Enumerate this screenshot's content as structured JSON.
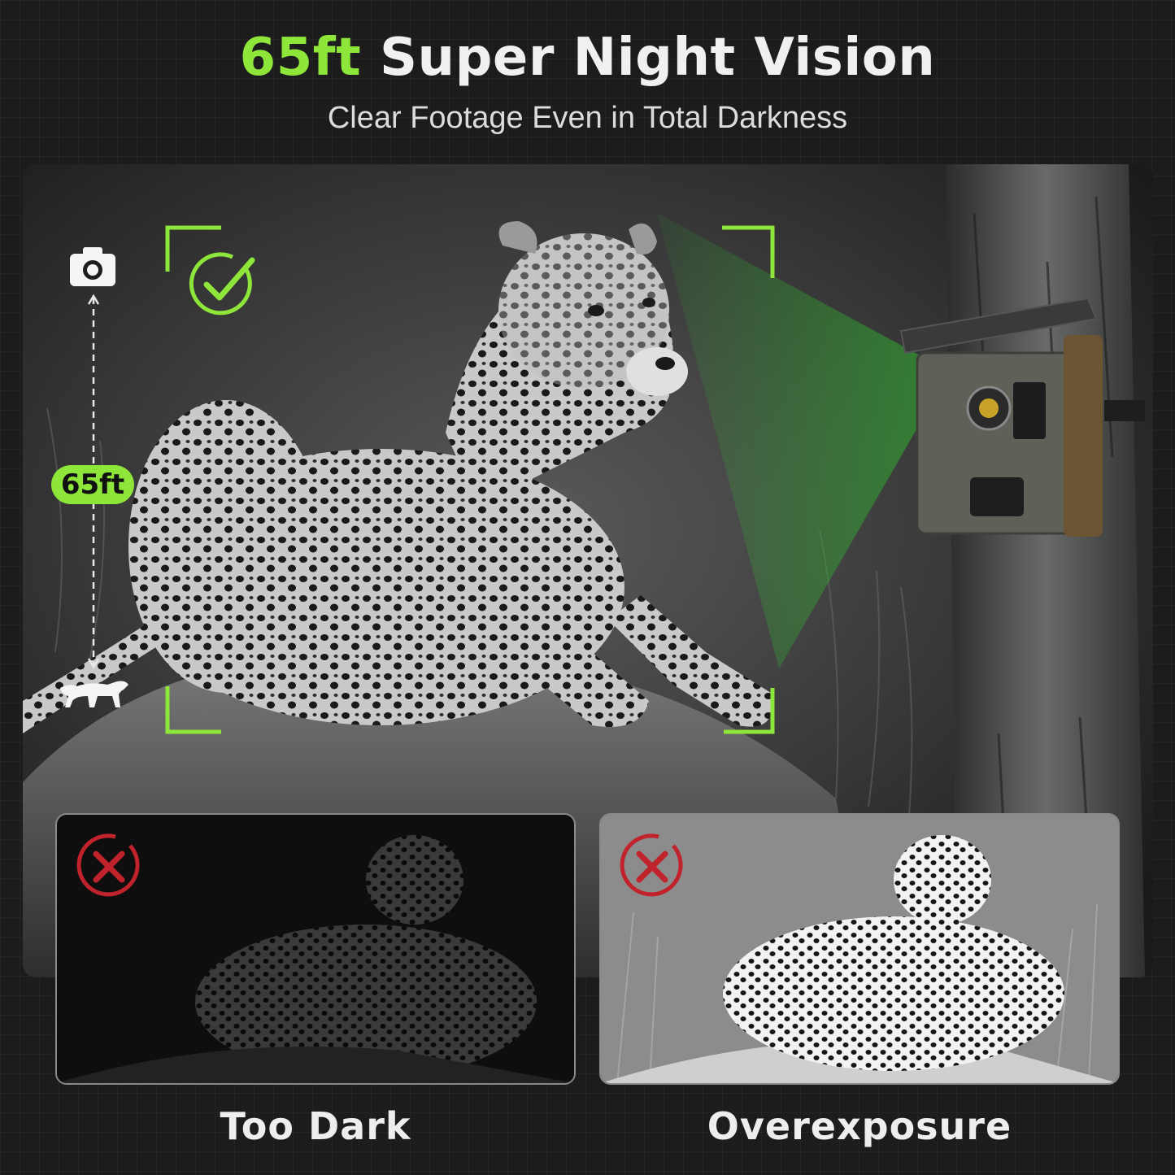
{
  "headline": {
    "accent": "65ft",
    "rest": " Super Night Vision"
  },
  "subtitle": "Clear Footage Even in Total Darkness",
  "distance_badge": "65ft",
  "comparison": [
    {
      "label": "Too Dark",
      "status_icon": "x-circle-icon"
    },
    {
      "label": "Overexposure",
      "status_icon": "x-circle-icon"
    }
  ],
  "colors": {
    "accent_green": "#8ee63a",
    "error_red": "#c0232b",
    "background": "#1e1e1e"
  },
  "icons": [
    "camera-icon",
    "checkmark-circle-icon",
    "leopard-silhouette-icon",
    "x-circle-icon"
  ]
}
